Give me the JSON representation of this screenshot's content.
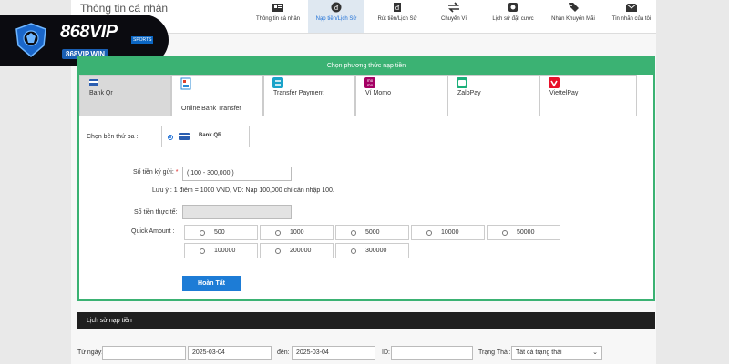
{
  "header": {
    "title": "Thông tin cá nhân",
    "tabs": [
      {
        "label": "Thông tin cá nhân",
        "icon": "id-card-icon",
        "active": false
      },
      {
        "label": "Nạp tiền/Lịch Sử",
        "icon": "deposit-coin-icon",
        "active": true
      },
      {
        "label": "Rút tiền/Lịch Sử",
        "icon": "withdraw-icon",
        "active": false
      },
      {
        "label": "Chuyển Ví",
        "icon": "transfer-arrows-icon",
        "active": false
      },
      {
        "label": "Lịch sử đặt cược",
        "icon": "bet-history-icon",
        "active": false
      },
      {
        "label": "Nhận Khuyến Mãi",
        "icon": "tag-icon",
        "active": false
      },
      {
        "label": "Tin nhắn của tôi",
        "icon": "mail-icon",
        "active": false
      }
    ]
  },
  "logo": {
    "brand": "868VIP",
    "sports": "SPORTS",
    "url": "868VIP.WIN"
  },
  "deposit": {
    "panel_title": "Chọn phương thức nạp tiền",
    "methods": [
      {
        "label": "Bank Qr",
        "icon": "bank-qr-icon",
        "active": true
      },
      {
        "label": "Online Bank Transfer",
        "icon": "online-bank-icon",
        "active": false
      },
      {
        "label": "Transfer Payment",
        "icon": "transfer-payment-icon",
        "active": false
      },
      {
        "label": "Ví Momo",
        "icon": "momo-icon",
        "active": false
      },
      {
        "label": "ZaloPay",
        "icon": "zalopay-icon",
        "active": false
      },
      {
        "label": "ViettelPay",
        "icon": "viettelpay-icon",
        "active": false
      }
    ],
    "third_party_label": "Chọn bên thứ ba :",
    "third_party_option": "Bank QR",
    "amount_label": "Số tiền ký gửi:",
    "amount_required": "*",
    "amount_placeholder": "( 100 - 300,000 )",
    "note": "Lưu ý : 1 điểm = 1000 VND, VD: Nạp 100,000 chỉ cần nhập 100.",
    "actual_label": "Số tiền thực tế:",
    "actual_value": "",
    "quick_label": "Quick Amount :",
    "quick_amounts": [
      "500",
      "1000",
      "5000",
      "10000",
      "50000",
      "100000",
      "200000",
      "300000"
    ],
    "submit_label": "Hoàn Tất"
  },
  "history": {
    "title": "Lịch sử nạp tiền",
    "from_label": "Từ ngày:",
    "from_value": "",
    "date_start": "2025-03-04",
    "to_label": "đến:",
    "date_end": "2025-03-04",
    "id_label": "ID:",
    "id_value": "",
    "status_label": "Trạng Thái:",
    "status_value": "Tất cả trạng thái"
  },
  "colors": {
    "accent_green": "#3bb273",
    "button_blue": "#1d7cd6",
    "dark_bar": "#1f1f1f",
    "active_tab": "#dfe8f1"
  }
}
